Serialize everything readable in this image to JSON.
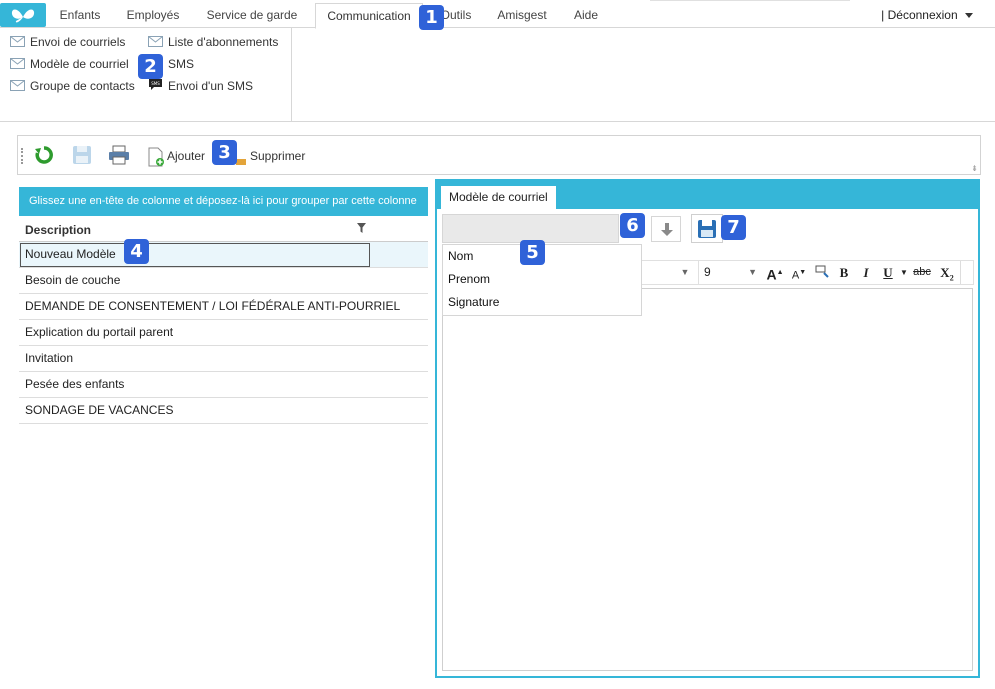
{
  "nav": {
    "tabs": [
      {
        "label": "Enfants"
      },
      {
        "label": "Employés"
      },
      {
        "label": "Service de garde"
      },
      {
        "label": "Communication"
      },
      {
        "label": "Outils"
      },
      {
        "label": "Amisgest"
      },
      {
        "label": "Aide"
      }
    ],
    "active_tab": "Communication",
    "logout_label": "|  Déconnexion"
  },
  "submenu": {
    "items": [
      {
        "label": "Envoi de courriels",
        "icon": "envelope-icon"
      },
      {
        "label": "Modèle de courriel",
        "icon": "envelope-icon"
      },
      {
        "label": "Groupe de contacts",
        "icon": "envelope-icon"
      },
      {
        "label": "Liste d'abonnements",
        "icon": "envelope-icon"
      },
      {
        "label": "SMS",
        "icon": "sms-icon"
      },
      {
        "label": "Envoi d'un SMS",
        "icon": "sms-bubble-icon"
      }
    ]
  },
  "toolbar": {
    "add_label": "Ajouter",
    "delete_label": "Supprimer"
  },
  "grid": {
    "group_panel_text": "Glissez une en-tête de colonne et déposez-là ici pour grouper par cette colonne",
    "column_header": "Description",
    "rows": [
      "Nouveau Modèle",
      "Besoin de couche",
      "DEMANDE DE CONSENTEMENT / LOI FÉDÉRALE ANTI-POURRIEL",
      "Explication du portail parent",
      "Invitation",
      "Pesée des enfants",
      "SONDAGE DE VACANCES"
    ],
    "selected_row": 0
  },
  "editor": {
    "tab_label": "Modèle de courriel",
    "merge_fields": [
      "Nom",
      "Prenom",
      "Signature"
    ],
    "font_size": "9",
    "format_buttons": [
      "A",
      "A",
      "B",
      "I",
      "U",
      "abc",
      "X"
    ]
  },
  "callouts": [
    "1",
    "2",
    "3",
    "4",
    "5",
    "6",
    "7"
  ],
  "colors": {
    "accent": "#35b6d8",
    "badge": "#2f62d8"
  }
}
